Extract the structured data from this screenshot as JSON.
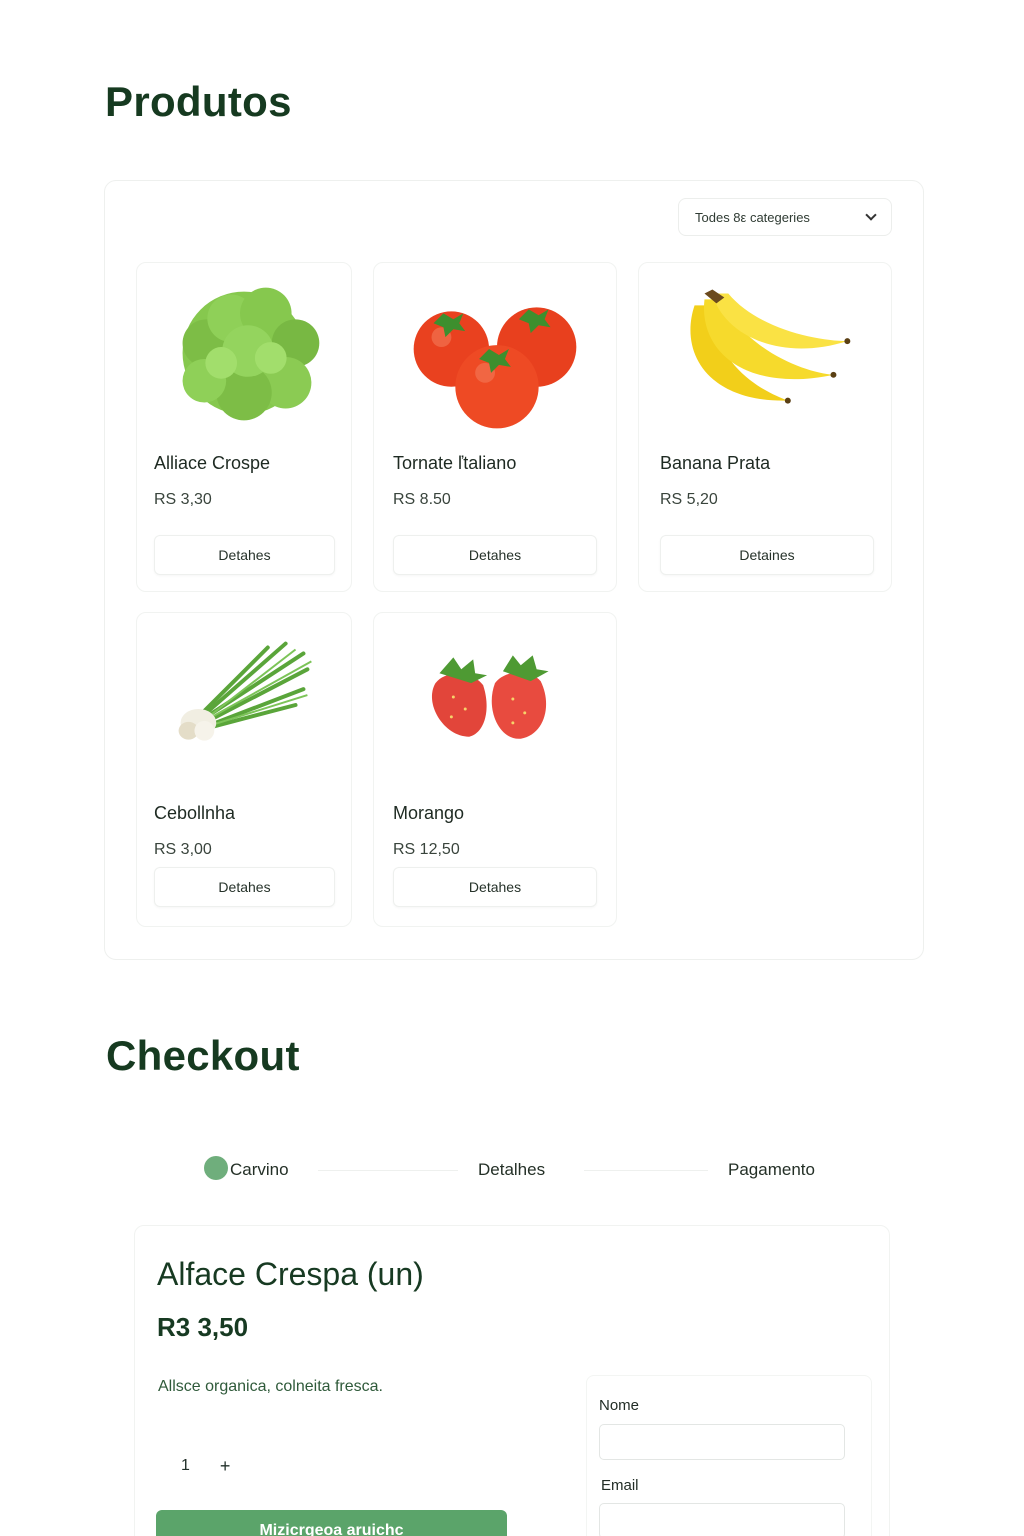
{
  "products_section": {
    "title": "Produtos",
    "category_select": {
      "value": "Todes 8ε categeries"
    },
    "products": [
      {
        "name": "Alliace Crospe",
        "price": "RS 3,30",
        "button": "Detahes",
        "image": "lettuce"
      },
      {
        "name": "Tornate ľtaliano",
        "price": "RS 8.50",
        "button": "Detahes",
        "image": "tomatoes"
      },
      {
        "name": "Banana Prata",
        "price": "RS 5,20",
        "button": "Detaines",
        "image": "bananas"
      },
      {
        "name": "Cebollnha",
        "price": "RS 3,00",
        "button": "Detahes",
        "image": "green-onion"
      },
      {
        "name": "Morango",
        "price": "RS 12,50",
        "button": "Detahes",
        "image": "strawberries"
      }
    ]
  },
  "checkout": {
    "title": "Checkout",
    "steps": [
      "Carvino",
      "Detalhes",
      "Pagamento"
    ],
    "active_step_color": "#6fae7c",
    "item_title": "Alface Crespa (un)",
    "item_price": "R3 3,50",
    "item_description": "Allsce organica, colneita fresca.",
    "quantity": "1",
    "quantity_plus": "+",
    "cta_label": "Mizicrgeoa aruichc",
    "cta_color": "#5ba46a",
    "form": {
      "name_label": "Nome",
      "email_label": "Email"
    }
  }
}
